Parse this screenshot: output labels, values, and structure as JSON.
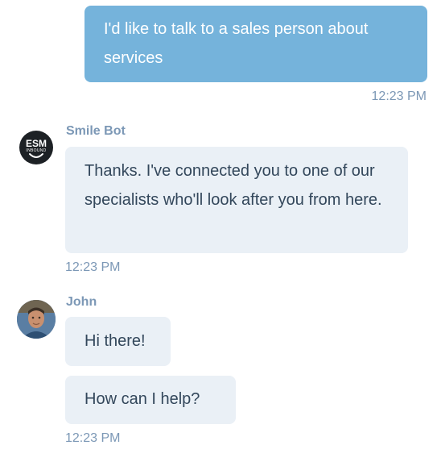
{
  "messages": {
    "outgoing": {
      "text": "I'd like to talk to a sales person about services",
      "time": "12:23 PM"
    },
    "bot": {
      "sender": "Smile Bot",
      "avatar_line1": "ESM",
      "avatar_line2": "INBOUND",
      "text": "Thanks. I've connected you to one of our specialists who'll look after you from here.",
      "time": "12:23 PM"
    },
    "john": {
      "sender": "John",
      "avatar": "person-photo-avatar",
      "messages": [
        "Hi there!",
        "How can I help?"
      ],
      "time": "12:23 PM"
    }
  },
  "colors": {
    "outgoing_bubble": "#75b3db",
    "incoming_bubble": "#eaf0f6",
    "meta_text": "#7c98b6",
    "body_text": "#33475b",
    "bot_avatar_bg": "#1d2125"
  }
}
